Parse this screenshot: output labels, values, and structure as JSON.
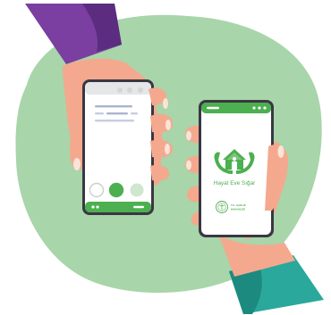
{
  "illustration": {
    "subject": "Two hands holding smartphones, one displaying the Hayat Eve Sığar app",
    "colors": {
      "background_blob": "#a8d5a9",
      "app_green": "#4caf50",
      "app_green_light": "#7cc47e",
      "phone_frame": "#3a3743",
      "skin": "#f4a98e",
      "skin_shadow": "#e98f74",
      "sleeve_left": "#7a3fa0",
      "sleeve_right": "#2aa89b"
    },
    "left_phone": {
      "buttons": [
        "outline-circle",
        "filled-circle",
        "light-circle"
      ]
    },
    "right_phone": {
      "app_name": "Hayat Eve Sığar",
      "ministry_line1": "T.C. SAĞLIK",
      "ministry_line2": "BAKANLIĞI",
      "icons": [
        "house-in-hands-icon",
        "ministry-logo-icon"
      ]
    }
  }
}
